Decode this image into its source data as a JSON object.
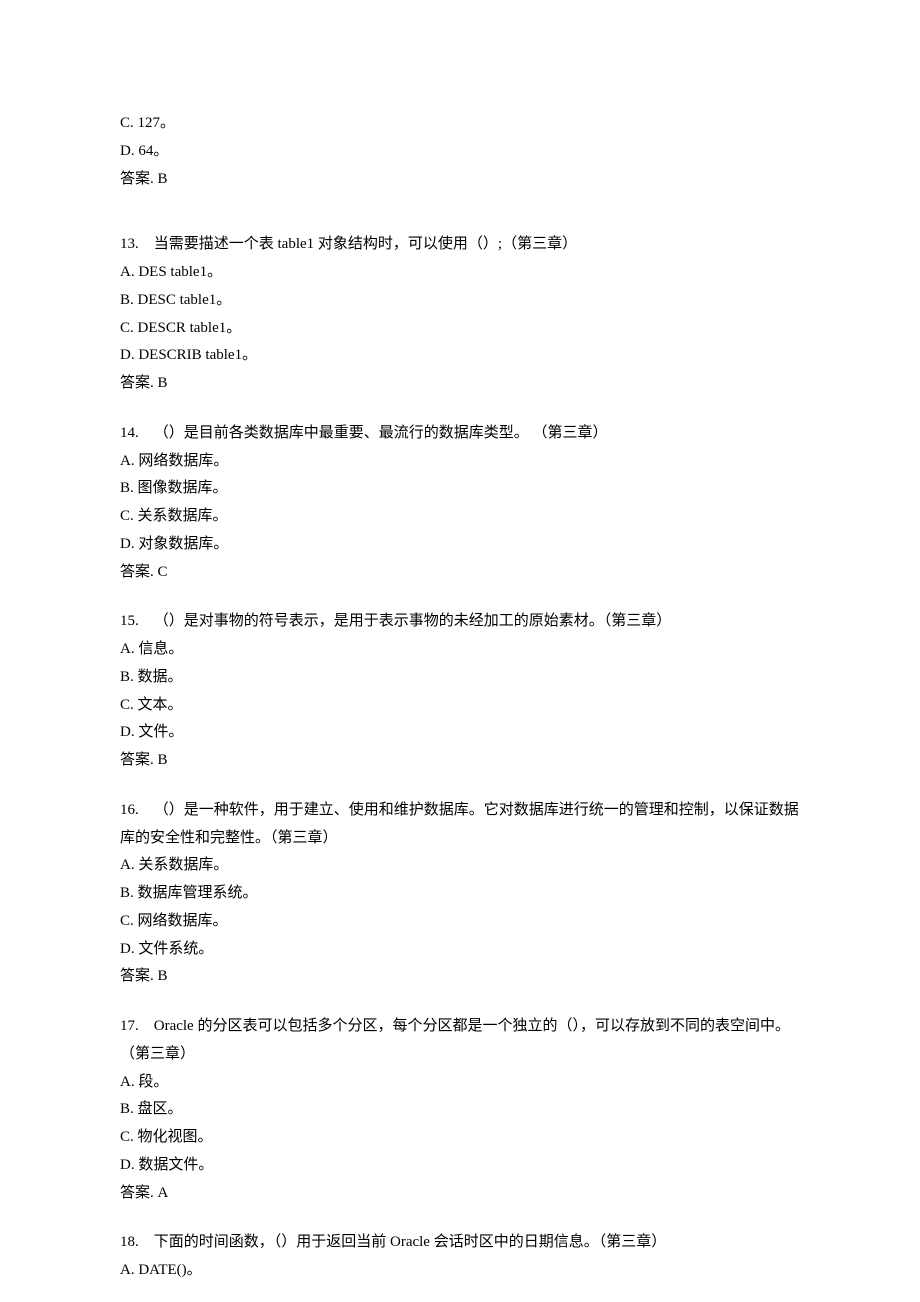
{
  "prelude": [
    "C. 127。",
    "D. 64。",
    "答案. B"
  ],
  "questions": [
    {
      "num": "13.",
      "stem": "当需要描述一个表 table1 对象结构时，可以使用（）;（第三章）",
      "options": [
        "A. DES table1。",
        "B. DESC table1。",
        "C. DESCR table1。",
        "D. DESCRIB table1。"
      ],
      "answer": "答案. B"
    },
    {
      "num": "14.",
      "stem": "（）是目前各类数据库中最重要、最流行的数据库类型。 （第三章）",
      "options": [
        "A.  网络数据库。",
        "B.  图像数据库。",
        "C.  关系数据库。",
        "D.  对象数据库。"
      ],
      "answer": "答案. C"
    },
    {
      "num": "15.",
      "stem": "（）是对事物的符号表示，是用于表示事物的未经加工的原始素材。（第三章）",
      "options": [
        "A.  信息。",
        "B.  数据。",
        "C.  文本。",
        "D.  文件。"
      ],
      "answer": "答案. B"
    },
    {
      "num": "16.",
      "stem": "（）是一种软件，用于建立、使用和维护数据库。它对数据库进行统一的管理和控制，以保证数据库的安全性和完整性。（第三章）",
      "options": [
        "A.  关系数据库。",
        "B.  数据库管理系统。",
        "C.  网络数据库。",
        "D.  文件系统。"
      ],
      "answer": "答案. B"
    },
    {
      "num": "17.",
      "stem": "Oracle 的分区表可以包括多个分区，每个分区都是一个独立的（），可以存放到不同的表空间中。（第三章）",
      "options": [
        "A.  段。",
        "B.  盘区。",
        "C.  物化视图。",
        "D.  数据文件。"
      ],
      "answer": "答案. A"
    },
    {
      "num": "18.",
      "stem": "下面的时间函数，（）用于返回当前 Oracle 会话时区中的日期信息。（第三章）",
      "options": [
        "A. DATE()。"
      ],
      "answer": null
    }
  ]
}
